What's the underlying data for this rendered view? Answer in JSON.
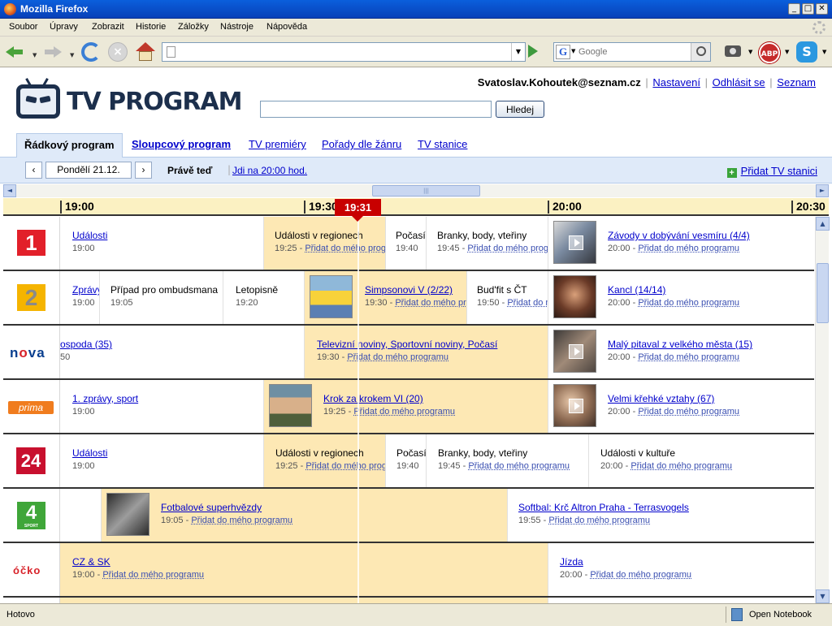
{
  "window": {
    "title": "Mozilla Firefox",
    "min": "_",
    "max": "□",
    "close": "✕"
  },
  "menu": [
    "Soubor",
    "Úpravy",
    "Zobrazit",
    "Historie",
    "Záložky",
    "Nástroje",
    "Nápověda"
  ],
  "toolbar": {
    "url": "",
    "search_placeholder": "Google",
    "abp": "ABP",
    "skype": "S"
  },
  "site": {
    "logo_text": "TV PROGRAM",
    "search_value": "",
    "search_button": "Hledej",
    "user": "Svatoslav.Kohoutek@seznam.cz",
    "links": [
      "Nastavení",
      "Odhlásit se",
      "Seznam"
    ]
  },
  "tabs": [
    "Řádkový program",
    "Sloupcový program",
    "TV premiéry",
    "Pořady dle žánru",
    "TV stanice"
  ],
  "daybar": {
    "prev": "‹",
    "day": "Pondělí 21.12.",
    "next": "›",
    "now": "Právě teď",
    "goto": "Jdi na 20:00 hod.",
    "add_station": "Přidat TV stanici",
    "add_station_plus": "+"
  },
  "hscroll": {
    "left": "◄",
    "thumb": "|||",
    "right": "►"
  },
  "timeline": {
    "ticks": [
      "19:00",
      "19:30",
      "20:00",
      "20:30"
    ],
    "now": "19:31"
  },
  "add_label": "Přidat do mého programu",
  "channels": [
    {
      "name": "1",
      "programs": [
        {
          "title": "Události",
          "time": "19:00",
          "add": false,
          "link": true
        },
        {
          "title": "Události v regionech",
          "time": "19:25",
          "add": true,
          "link": false
        },
        {
          "title": "Počasí",
          "time": "19:40",
          "add": false,
          "link": false
        },
        {
          "title": "Branky, body, vteřiny",
          "time": "19:45",
          "add": true,
          "link": false
        },
        {
          "title": "Závody v dobývání vesmíru (4/4)",
          "time": "20:00",
          "add": true,
          "link": true
        }
      ]
    },
    {
      "name": "2",
      "programs": [
        {
          "title": "Zprávy",
          "time": "19:00",
          "add": false,
          "link": true
        },
        {
          "title": "Případ pro ombudsmana",
          "time": "19:05",
          "add": false,
          "link": false
        },
        {
          "title": "Letopisně",
          "time": "19:20",
          "add": false,
          "link": false
        },
        {
          "title": "Simpsonovi V (2/22)",
          "time": "19:30",
          "add": true,
          "link": true
        },
        {
          "title": "Bud'fit s ČT",
          "time": "19:50",
          "add": true,
          "link": false
        },
        {
          "title": "Kancl (14/14)",
          "time": "20:00",
          "add": true,
          "link": true
        }
      ]
    },
    {
      "name": "nova",
      "programs": [
        {
          "title": "ospoda (35)",
          "time": "50",
          "add": false,
          "link": true
        },
        {
          "title": "Televizní noviny, Sportovní noviny, Počasí",
          "time": "19:30",
          "add": true,
          "link": true
        },
        {
          "title": "Malý pitaval z velkého města (15)",
          "time": "20:00",
          "add": true,
          "link": true
        }
      ]
    },
    {
      "name": "prima",
      "programs": [
        {
          "title": "1. zprávy, sport",
          "time": "19:00",
          "add": false,
          "link": true
        },
        {
          "title": "Krok za krokem VI (20)",
          "time": "19:25",
          "add": true,
          "link": true
        },
        {
          "title": "Velmi křehké vztahy (67)",
          "time": "20:00",
          "add": true,
          "link": true
        }
      ]
    },
    {
      "name": "24",
      "programs": [
        {
          "title": "Události",
          "time": "19:00",
          "add": false,
          "link": true
        },
        {
          "title": "Události v regionech",
          "time": "19:25",
          "add": true,
          "link": false
        },
        {
          "title": "Počasí",
          "time": "19:40",
          "add": false,
          "link": false
        },
        {
          "title": "Branky, body, vteřiny",
          "time": "19:45",
          "add": true,
          "link": false
        },
        {
          "title": "Události v kultuře",
          "time": "20:00",
          "add": true,
          "link": false
        }
      ]
    },
    {
      "name": "4 SPORT",
      "programs": [
        {
          "title": "Fotbalové superhvězdy",
          "time": "19:05",
          "add": true,
          "link": true
        },
        {
          "title": "Softbal: Krč Altron Praha - Terrasvogels",
          "time": "19:55",
          "add": true,
          "link": true
        }
      ]
    },
    {
      "name": "óčko",
      "programs": [
        {
          "title": "CZ & SK",
          "time": "19:00",
          "add": true,
          "link": true
        },
        {
          "title": "Jízda",
          "time": "20:00",
          "add": true,
          "link": true
        }
      ]
    }
  ],
  "status": {
    "text": "Hotovo",
    "notebook": "Open Notebook"
  },
  "vscroll": {
    "up": "▲",
    "down": "▼"
  },
  "colors": {
    "highlight": "#fde8b4",
    "link": "#0000cc",
    "now_flag": "#c80000",
    "timeline_bg": "#fbf1c2"
  }
}
